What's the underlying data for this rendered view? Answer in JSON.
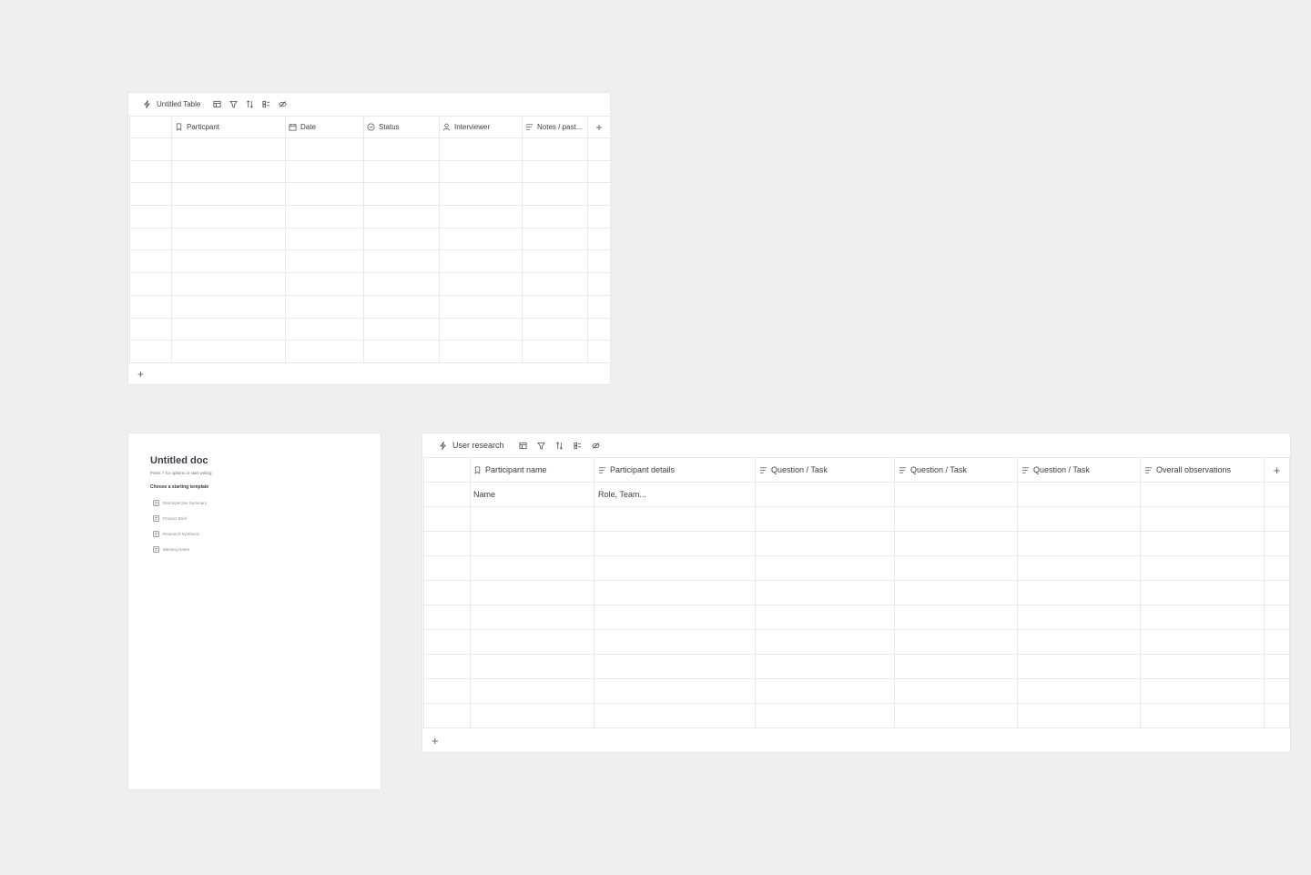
{
  "table1": {
    "title": "Untitled Table",
    "columns": [
      {
        "label": "Particpant",
        "icon": "bookmark-icon"
      },
      {
        "label": "Date",
        "icon": "calendar-icon"
      },
      {
        "label": "Status",
        "icon": "status-icon"
      },
      {
        "label": "Interviewer",
        "icon": "person-icon"
      },
      {
        "label": "Notes / past...",
        "icon": "text-lines-icon"
      }
    ],
    "add_column": "+",
    "add_row": "+",
    "rows": 10
  },
  "doc": {
    "title": "Untitled doc",
    "hint": "Press '/' for options or start writing",
    "templates_heading": "Choose a starting template",
    "templates": [
      "Retrospective Summary",
      "Product Brief",
      "Research Synthesis",
      "Meeting Notes"
    ]
  },
  "table2": {
    "title": "User research",
    "columns": [
      {
        "label": "Participant name",
        "icon": "bookmark-icon"
      },
      {
        "label": "Participant details",
        "icon": "text-lines-icon"
      },
      {
        "label": "Question / Task",
        "icon": "text-lines-icon"
      },
      {
        "label": "Question / Task",
        "icon": "text-lines-icon"
      },
      {
        "label": "Question / Task",
        "icon": "text-lines-icon"
      },
      {
        "label": "Overall observations",
        "icon": "text-lines-icon"
      }
    ],
    "first_row": [
      "Name",
      "Role, Team...",
      "",
      "",
      "",
      ""
    ],
    "add_column": "+",
    "add_row": "+",
    "rows": 10
  }
}
